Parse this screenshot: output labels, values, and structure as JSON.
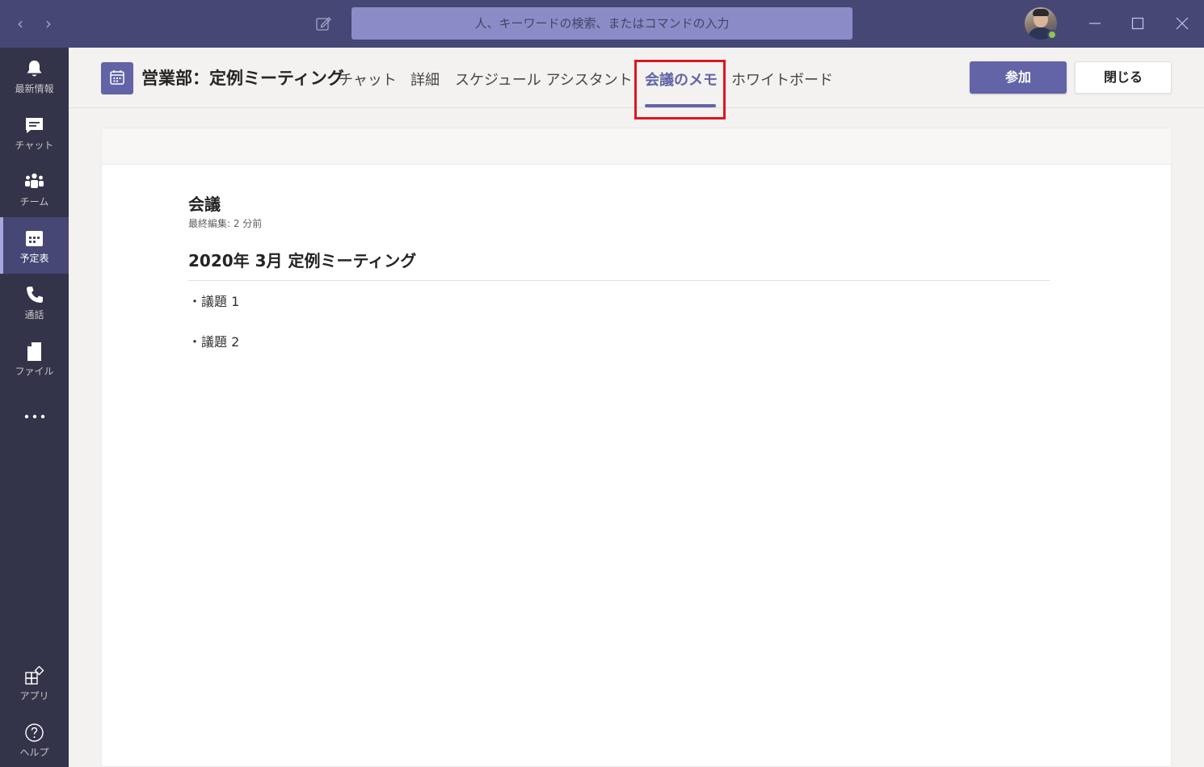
{
  "titlebar": {
    "search_placeholder": "人、キーワードの検索、またはコマンドの入力"
  },
  "rail": {
    "items": [
      {
        "label": "最新情報",
        "icon": "bell-icon"
      },
      {
        "label": "チャット",
        "icon": "chat-icon"
      },
      {
        "label": "チーム",
        "icon": "teams-icon"
      },
      {
        "label": "予定表",
        "icon": "calendar-icon"
      },
      {
        "label": "通話",
        "icon": "phone-icon"
      },
      {
        "label": "ファイル",
        "icon": "file-icon"
      }
    ],
    "bottom": [
      {
        "label": "アプリ",
        "icon": "apps-icon"
      },
      {
        "label": "ヘルプ",
        "icon": "help-icon"
      }
    ]
  },
  "header": {
    "title": "営業部：定例ミーティング",
    "tabs": [
      {
        "label": "チャット"
      },
      {
        "label": "詳細"
      },
      {
        "label": "スケジュール アシスタント"
      },
      {
        "label": "会議のメモ",
        "active": true
      },
      {
        "label": "ホワイトボード"
      }
    ],
    "join_label": "参加",
    "close_label": "閉じる"
  },
  "notes": {
    "title": "会議",
    "last_edited": "最終編集: 2 分前",
    "heading": "2020年 3月 定例ミーティング",
    "lines": [
      "・議題 1",
      "・議題 2"
    ]
  },
  "colors": {
    "titlebar": "#464775",
    "rail": "#33344a",
    "accent": "#6264a7",
    "highlight": "#e0141e"
  }
}
